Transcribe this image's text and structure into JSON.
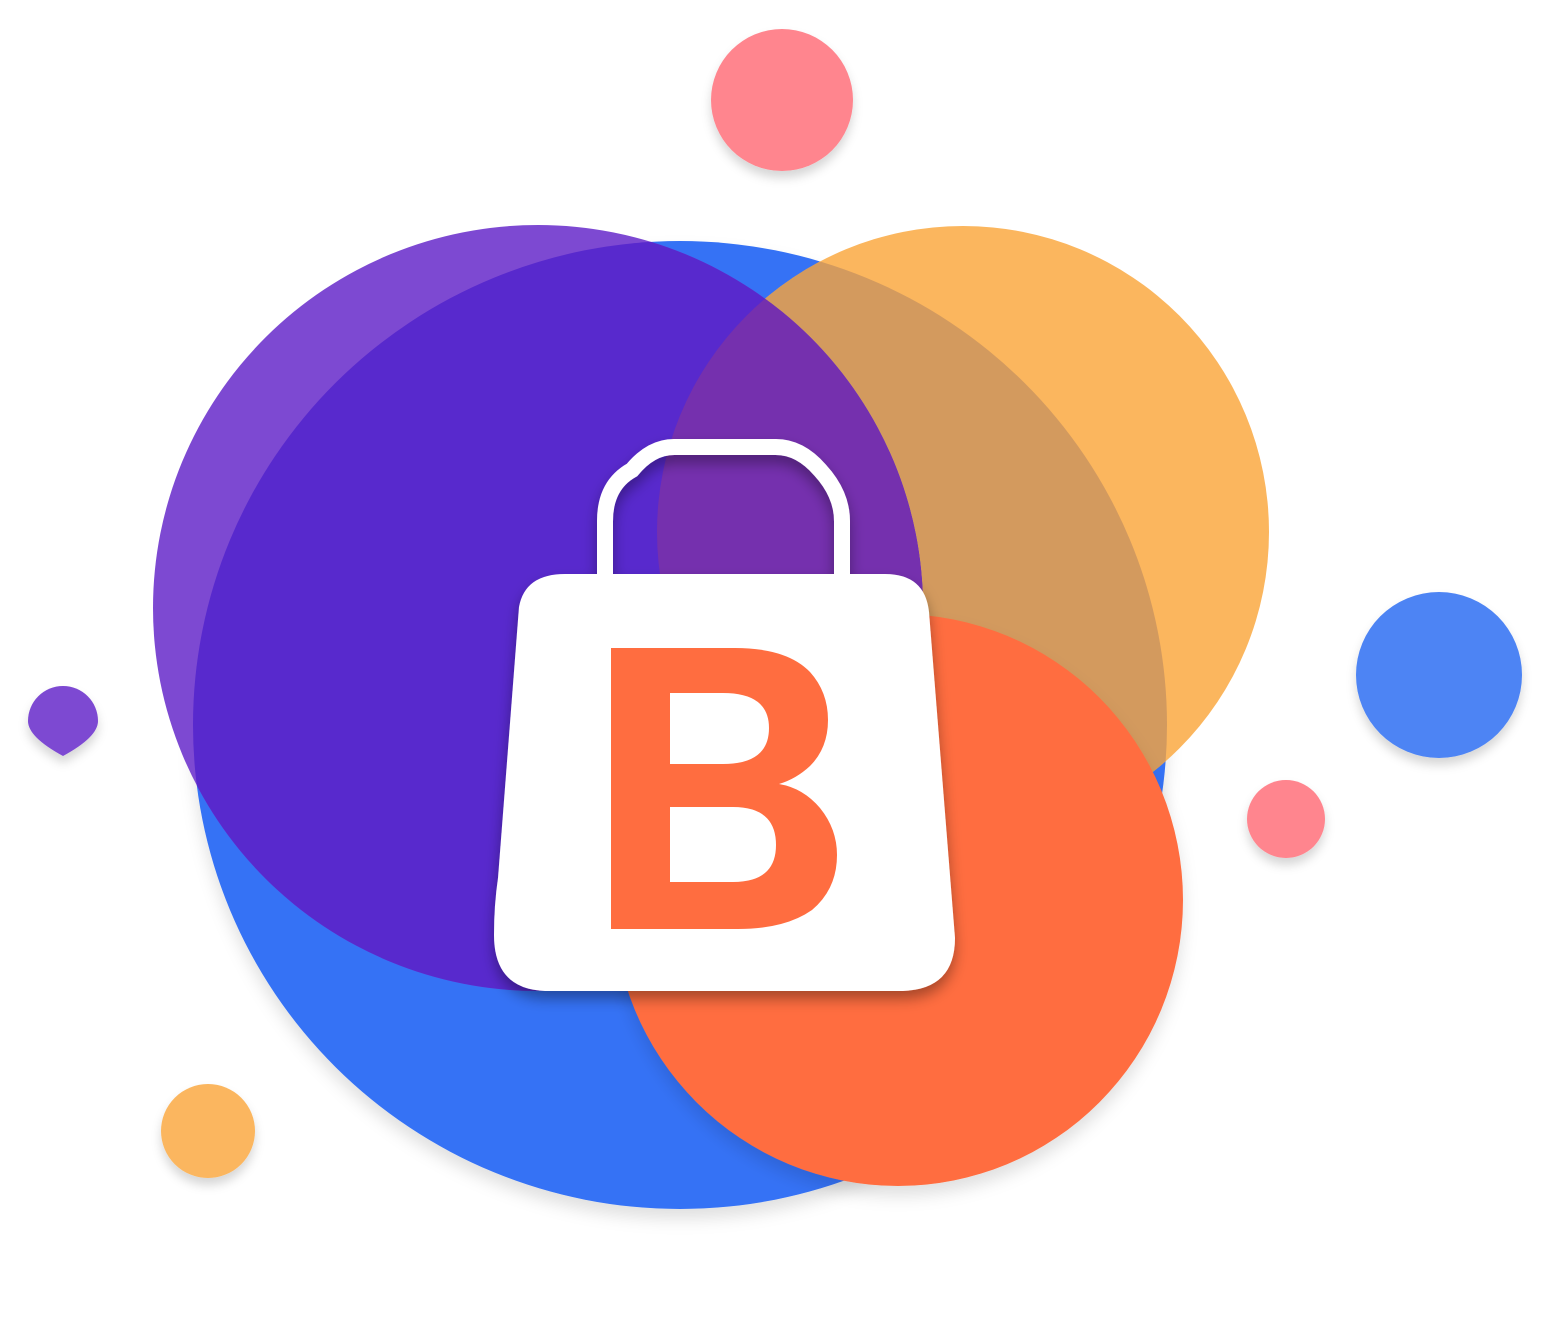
{
  "logo": {
    "letter": "B",
    "icon": "shopping-bag-icon",
    "colors": {
      "blue": "#3672F5",
      "purple": "#7D49D2",
      "purple_overlap": "#5829CD",
      "orange_light": "#FBB65E",
      "orange_light_overlap": "#D39A5E",
      "purple_orange_overlap": "#7530AE",
      "orange": "#FF6D40",
      "pink": "#FF858E",
      "blue_light": "#4D84F4",
      "bag": "#FFFFFF"
    }
  }
}
